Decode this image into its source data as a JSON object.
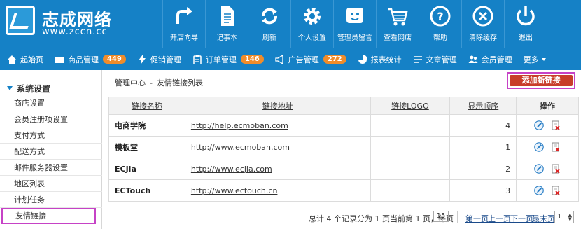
{
  "header": {
    "logo_name": "志成网络",
    "logo_url": "www.zccn.cc",
    "top_nav": [
      {
        "icon": "arrow-turn-right-icon",
        "label": "开店向导"
      },
      {
        "icon": "notepad-icon",
        "label": "记事本"
      },
      {
        "icon": "refresh-icon",
        "label": "刷新"
      },
      {
        "icon": "gear-icon",
        "label": "个人设置"
      },
      {
        "icon": "smiley-message-icon",
        "label": "管理员留言"
      },
      {
        "icon": "shopping-cart-icon",
        "label": "查看网店"
      },
      {
        "icon": "help-icon",
        "label": "帮助"
      },
      {
        "icon": "clear-x-icon",
        "label": "清除缓存"
      },
      {
        "icon": "power-icon",
        "label": "退出"
      }
    ]
  },
  "subnav": {
    "items": [
      {
        "icon": "home-icon",
        "label": "起始页"
      },
      {
        "icon": "folder-icon",
        "label": "商品管理",
        "badge": "449"
      },
      {
        "icon": "bolt-icon",
        "label": "促销管理"
      },
      {
        "icon": "clipboard-icon",
        "label": "订单管理",
        "badge": "146"
      },
      {
        "icon": "megaphone-icon",
        "label": "广告管理",
        "badge": "272"
      },
      {
        "icon": "pie-chart-icon",
        "label": "报表统计"
      },
      {
        "icon": "list-icon",
        "label": "文章管理"
      },
      {
        "icon": "users-icon",
        "label": "会员管理"
      }
    ],
    "more_label": "更多"
  },
  "sidebar": {
    "title": "系统设置",
    "items": [
      {
        "label": "商店设置"
      },
      {
        "label": "会员注册项设置"
      },
      {
        "label": "支付方式"
      },
      {
        "label": "配送方式"
      },
      {
        "label": "邮件服务器设置"
      },
      {
        "label": "地区列表"
      },
      {
        "label": "计划任务"
      },
      {
        "label": "友情链接"
      }
    ],
    "active_index": 7
  },
  "main": {
    "breadcrumb": {
      "root": "管理中心",
      "sep": "-",
      "current": "友情链接列表"
    },
    "add_button_label": "添加新链接",
    "table": {
      "headers": [
        "链接名称",
        "链接地址",
        "链接LOGO",
        "显示顺序",
        "操作"
      ],
      "rows": [
        {
          "name": "电商学院",
          "url": "http://help.ecmoban.com",
          "logo": "",
          "order": "4"
        },
        {
          "name": "模板堂",
          "url": "http://www.ecmoban.com",
          "logo": "",
          "order": "1"
        },
        {
          "name": "ECJia",
          "url": "http://www.ecjia.com",
          "logo": "",
          "order": "2"
        },
        {
          "name": "ECTouch",
          "url": "http://www.ectouch.cn",
          "logo": "",
          "order": "3"
        }
      ],
      "row_actions": [
        "edit-icon",
        "delete-icon"
      ]
    },
    "pager": {
      "summary": "总计 4 个记录分为 1 页当前第 1 页，每页",
      "per_page": "15",
      "first": "第一页",
      "prev": "上一页",
      "next": "下一页",
      "last": "最末页",
      "page_select": "1"
    }
  },
  "colors": {
    "header_blue": "#1581c6",
    "badge_orange": "#f08c2a",
    "add_button_red": "#c83d2a",
    "highlight_purple": "#c642c6"
  }
}
